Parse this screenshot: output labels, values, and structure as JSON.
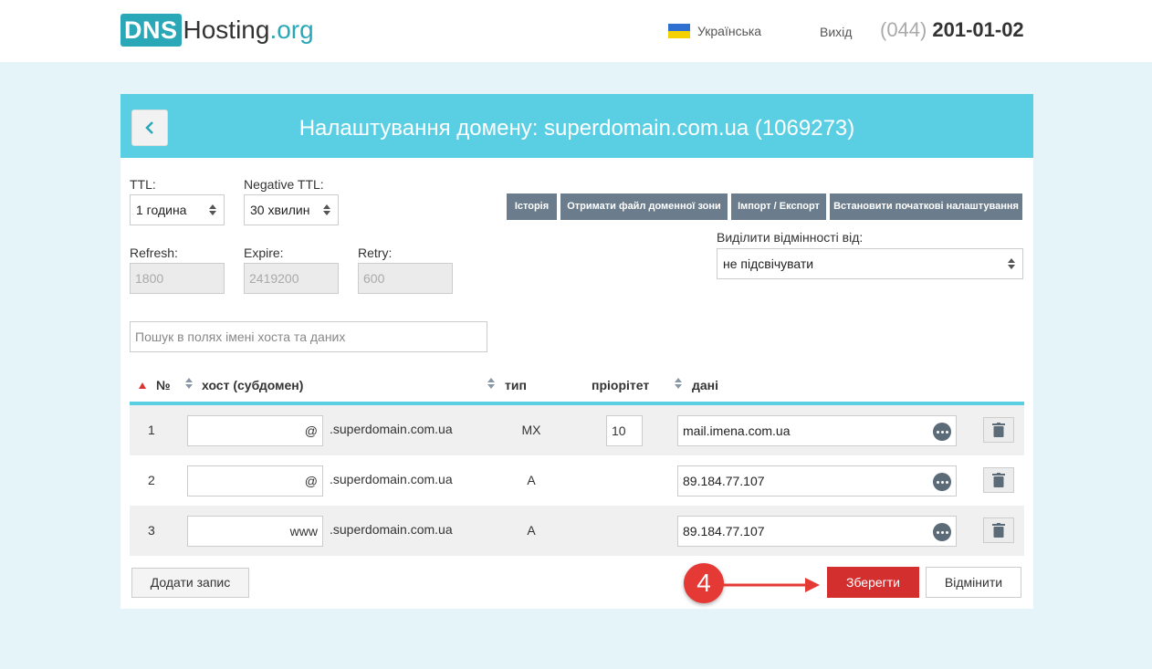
{
  "header": {
    "logo": {
      "box": "DNS",
      "main": "Hosting",
      "tld": ".org"
    },
    "language": "Українська",
    "logout": "Вихід",
    "phone": {
      "code": "(044)",
      "number": "201-01-02"
    }
  },
  "panel": {
    "title": "Налаштування домену: superdomain.com.ua (1069273)",
    "ttl": {
      "label": "TTL:",
      "value": "1 година"
    },
    "negative_ttl": {
      "label": "Negative TTL:",
      "value": "30 хвилин"
    },
    "refresh": {
      "label": "Refresh:",
      "value": "1800"
    },
    "expire": {
      "label": "Expire:",
      "value": "2419200"
    },
    "retry": {
      "label": "Retry:",
      "value": "600"
    },
    "buttons": {
      "history": "Історія",
      "get_zone_file": "Отримати файл доменної зони",
      "import_export": "Імпорт / Експорт",
      "reset_defaults": "Встановити початкові налаштування"
    },
    "highlight": {
      "label": "Виділити відмінності від:",
      "value": "не підсвічувати"
    },
    "search": {
      "placeholder": "Пошук в полях імені хоста та даних"
    }
  },
  "table": {
    "headers": {
      "num": "№",
      "host": "хост (субдомен)",
      "type": "тип",
      "priority": "пріорітет",
      "data": "дані"
    },
    "rows": [
      {
        "num": "1",
        "host": "@",
        "suffix": ".superdomain.com.ua",
        "type": "MX",
        "priority": "10",
        "data": "mail.imena.com.ua"
      },
      {
        "num": "2",
        "host": "@",
        "suffix": ".superdomain.com.ua",
        "type": "A",
        "priority": "",
        "data": "89.184.77.107"
      },
      {
        "num": "3",
        "host": "www",
        "suffix": ".superdomain.com.ua",
        "type": "A",
        "priority": "",
        "data": "89.184.77.107"
      }
    ]
  },
  "footer": {
    "add_record": "Додати запис",
    "save": "Зберегти",
    "cancel": "Відмінити",
    "step_marker": "4"
  },
  "colors": {
    "accent": "#5acfe3",
    "brand": "#2aa8b8",
    "save": "#d32f2f",
    "gray_button": "#6b7d8c"
  }
}
